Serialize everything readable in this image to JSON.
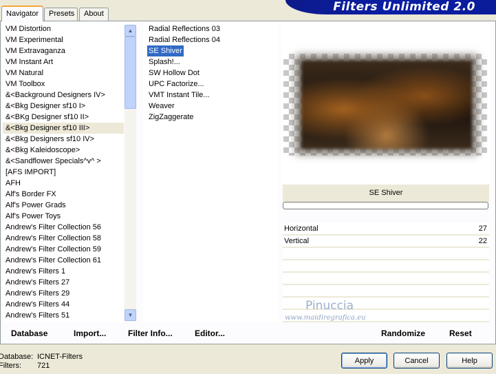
{
  "tabs": [
    {
      "label": "Navigator"
    },
    {
      "label": "Presets"
    },
    {
      "label": "About"
    }
  ],
  "app_title": "Filters Unlimited 2.0",
  "categories": [
    "VM Distortion",
    "VM Experimental",
    "VM Extravaganza",
    "VM Instant Art",
    "VM Natural",
    "VM Toolbox",
    "&<Background Designers IV>",
    "&<Bkg Designer sf10 I>",
    "&<BKg Designer sf10 II>",
    "&<Bkg Designer sf10 III>",
    "&<Bkg Designers sf10 IV>",
    "&<Bkg Kaleidoscope>",
    "&<Sandflower Specials^v^ >",
    "[AFS IMPORT]",
    "AFH",
    "Alf's Border FX",
    "Alf's Power Grads",
    "Alf's Power Toys",
    "Andrew's Filter Collection 56",
    "Andrew's Filter Collection 58",
    "Andrew's Filter Collection 59",
    "Andrew's Filter Collection 61",
    "Andrew's Filters 1",
    "Andrew's Filters 27",
    "Andrew's Filters 29",
    "Andrew's Filters 44",
    "Andrew's Filters 51"
  ],
  "selected_category": "&<Bkg Designer sf10 III>",
  "filters": [
    "Radial Reflections 03",
    "Radial Reflections 04",
    "SE Shiver",
    "Splash!...",
    "SW Hollow Dot",
    "UPC Factorize...",
    "VMT Instant Tile...",
    "Weaver",
    "ZigZaggerate"
  ],
  "selected_filter": "SE Shiver",
  "preview": {
    "filter_name": "SE Shiver"
  },
  "params": [
    {
      "label": "Horizontal",
      "value": "27"
    },
    {
      "label": "Vertical",
      "value": "22"
    }
  ],
  "watermark": {
    "name": "Pinuccia",
    "url": "www.maidiregrafica.eu"
  },
  "bottom_buttons": {
    "database": "Database",
    "import": "Import...",
    "filter_info": "Filter Info...",
    "editor": "Editor...",
    "randomize": "Randomize",
    "reset": "Reset"
  },
  "status": {
    "database_label": "Database:",
    "database_value": "ICNET-Filters",
    "filters_label": "Filters:",
    "filters_value": "721"
  },
  "dialog_buttons": {
    "apply": "Apply",
    "cancel": "Cancel",
    "help": "Help"
  },
  "colors": {
    "title_bar": "#0b1ea5",
    "selection": "#316ac5",
    "tab_accent": "#f5a53a"
  }
}
